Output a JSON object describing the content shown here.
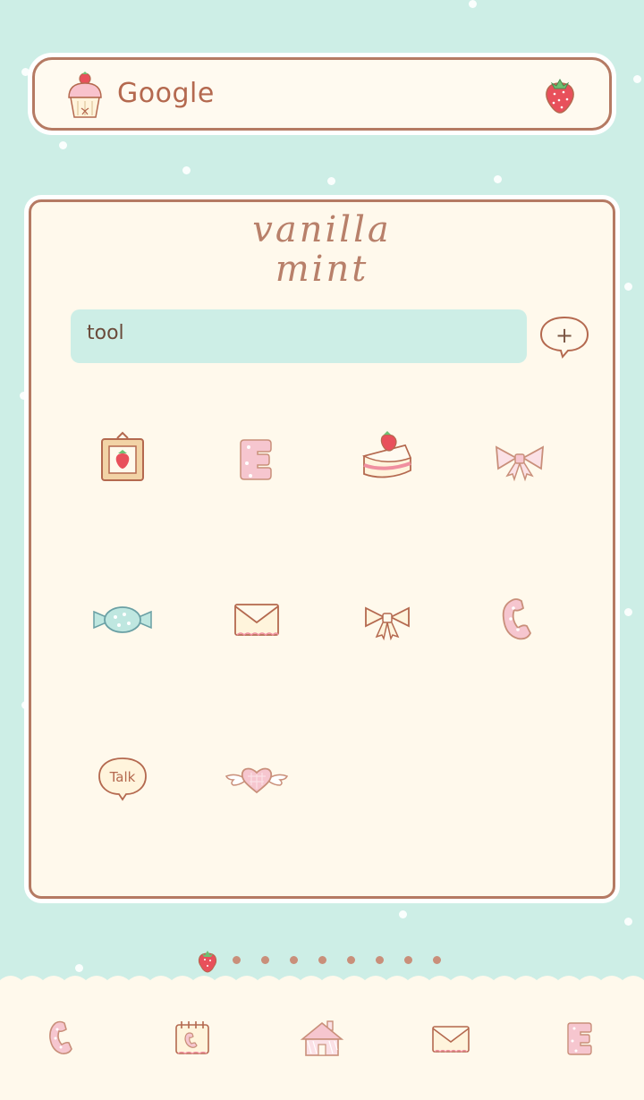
{
  "search": {
    "label": "Google"
  },
  "panel": {
    "title_line1": "vanilla",
    "title_line2": "mint",
    "folder_name": "tool",
    "add_symbol": "+"
  },
  "icons": [
    {
      "icon": "picture-frame-icon"
    },
    {
      "icon": "letter-e-icon"
    },
    {
      "icon": "strawberry-cake-icon"
    },
    {
      "icon": "ribbon-bow-icon"
    },
    {
      "icon": "candy-icon"
    },
    {
      "icon": "envelope-icon"
    },
    {
      "icon": "bow-icon"
    },
    {
      "icon": "phone-icon"
    },
    {
      "icon": "talk-bubble-icon",
      "text": "Talk"
    },
    {
      "icon": "winged-heart-icon"
    }
  ],
  "pager": {
    "current": 1,
    "total": 9
  },
  "dock": [
    {
      "icon": "phone-icon"
    },
    {
      "icon": "calendar-phone-icon"
    },
    {
      "icon": "house-icon"
    },
    {
      "icon": "envelope-icon"
    },
    {
      "icon": "letter-e-icon"
    }
  ],
  "colors": {
    "background": "#cdeee6",
    "panel": "#fff9ec",
    "border": "#b57a63",
    "accent_pink": "#f6c6cf",
    "strawberry": "#e8505b"
  }
}
